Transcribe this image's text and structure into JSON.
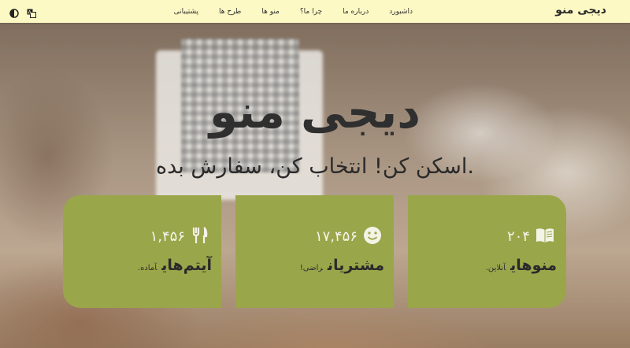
{
  "navbar": {
    "brand": "دیجی منو",
    "links": [
      "داشبورد",
      "درباره ما",
      "چرا ما؟",
      "منو ها",
      "طرح ها",
      "پشتیبانی"
    ],
    "icons": [
      "translate-icon",
      "theme-toggle-icon"
    ]
  },
  "hero": {
    "title": "دیجی منو",
    "tagline": "اسکن کن! انتخاب کن، سفارش بده."
  },
  "cards": [
    {
      "value": "۲۰۴",
      "label": "منوهای",
      "sub": "آنلاین.",
      "icon": "book-icon"
    },
    {
      "value": "۱۷,۴۵۶",
      "label": "مشتریان",
      "sub": "راضی!",
      "icon": "smile-icon"
    },
    {
      "value": "۱,۴۵۶",
      "label": "آیتم‌های",
      "sub": "آماده.",
      "icon": "fork-knife-icon"
    }
  ],
  "colors": {
    "navbar": "#fdf9c4",
    "card": "#9aa64a"
  }
}
